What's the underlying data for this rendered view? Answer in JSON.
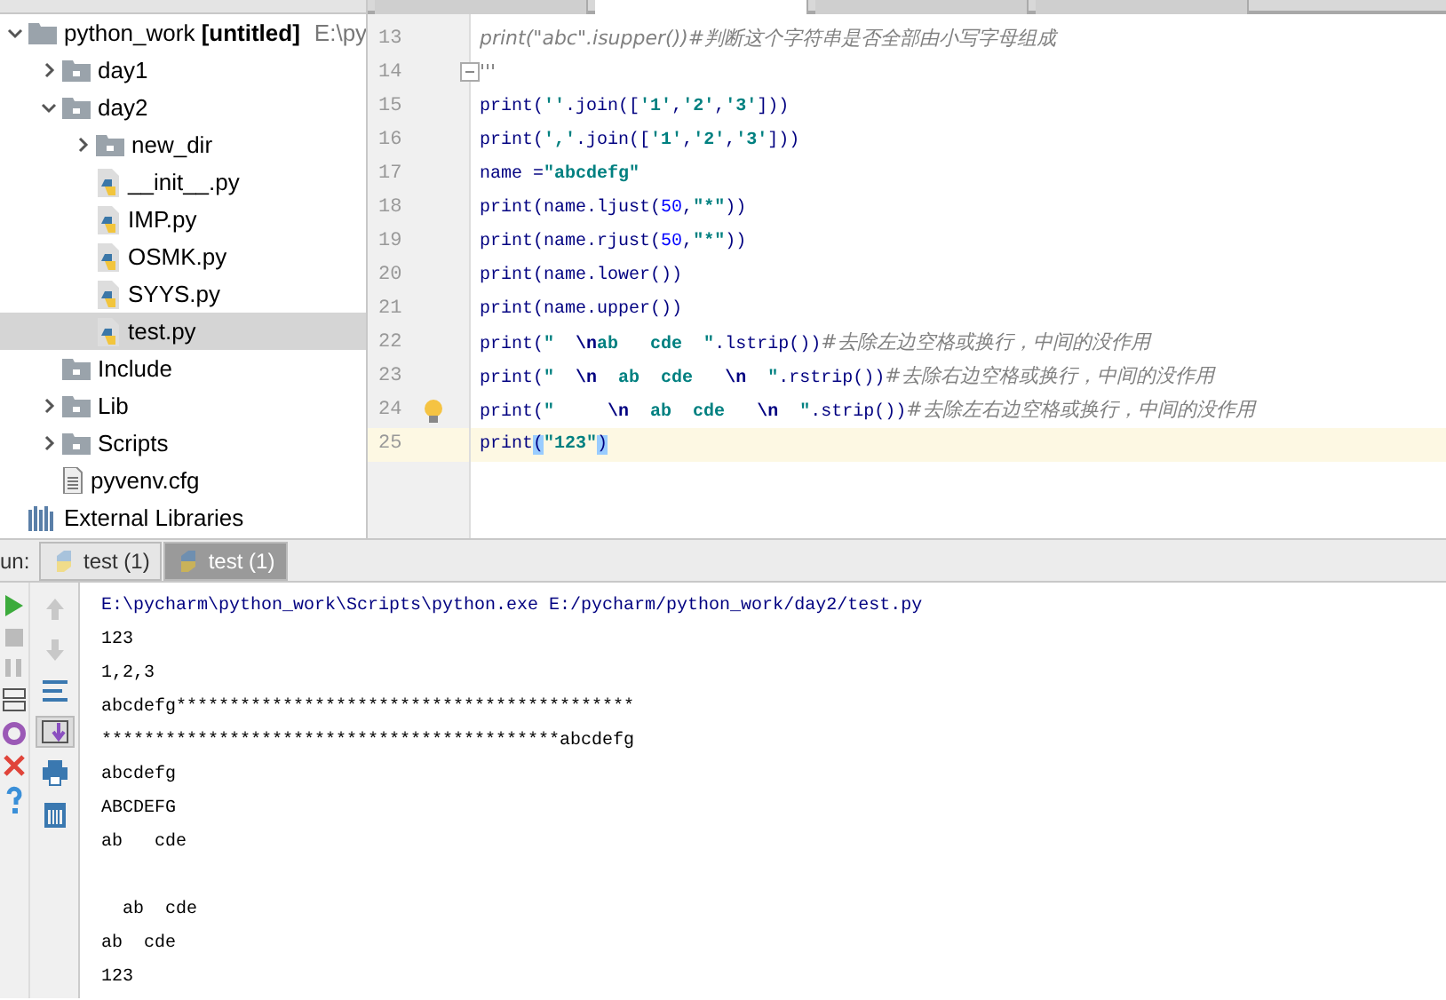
{
  "project_tree": [
    {
      "kind": "project",
      "label": "python_work **[untitled]**",
      "path": "E:\\py",
      "expanded": true,
      "selected": false,
      "children": [
        {
          "kind": "folder",
          "label": "day1",
          "expanded": false,
          "selected": false
        },
        {
          "kind": "folder",
          "label": "day2",
          "expanded": true,
          "selected": false,
          "children": [
            {
              "kind": "folder",
              "label": "new_dir",
              "expanded": false,
              "selected": false
            },
            {
              "kind": "pyfile",
              "label": "__init__.py",
              "selected": false
            },
            {
              "kind": "pyfile",
              "label": "IMP.py",
              "selected": false
            },
            {
              "kind": "pyfile",
              "label": "OSMK.py",
              "selected": false
            },
            {
              "kind": "pyfile",
              "label": "SYYS.py",
              "selected": false
            },
            {
              "kind": "pyfile",
              "label": "test.py",
              "selected": true
            }
          ]
        },
        {
          "kind": "folder",
          "label": "Include",
          "selected": false
        },
        {
          "kind": "folder",
          "label": "Lib",
          "expanded": false,
          "selected": false
        },
        {
          "kind": "folder",
          "label": "Scripts",
          "expanded": false,
          "selected": false
        },
        {
          "kind": "cfgfile",
          "label": "pyvenv.cfg",
          "selected": false
        }
      ]
    },
    {
      "kind": "libs",
      "label": "External Libraries",
      "selected": false
    }
  ],
  "editor_tabs": [
    {
      "selected": false
    },
    {
      "selected": true
    },
    {
      "selected": false
    },
    {
      "selected": false
    }
  ],
  "code_lines": [
    {
      "number": "13",
      "current": false,
      "fold": false,
      "bulb": false,
      "segments": [
        {
          "kind": "comment",
          "t": "print(\"abc\".isupper())#判断这个字符串是否全部由小写字母组成"
        }
      ]
    },
    {
      "number": "14",
      "current": false,
      "fold": true,
      "bulb": false,
      "segments": [
        {
          "kind": "comment",
          "t": "'''"
        }
      ]
    },
    {
      "number": "15",
      "current": false,
      "fold": false,
      "bulb": false,
      "segments": [
        {
          "kind": "code",
          "t": "print("
        },
        {
          "kind": "str",
          "t": "''"
        },
        {
          "kind": "code",
          "t": ".join(["
        },
        {
          "kind": "str",
          "t": "'1'"
        },
        {
          "kind": "code",
          "t": ","
        },
        {
          "kind": "str",
          "t": "'2'"
        },
        {
          "kind": "code",
          "t": ","
        },
        {
          "kind": "str",
          "t": "'3'"
        },
        {
          "kind": "code",
          "t": "]))"
        }
      ]
    },
    {
      "number": "16",
      "current": false,
      "fold": false,
      "bulb": false,
      "segments": [
        {
          "kind": "code",
          "t": "print("
        },
        {
          "kind": "str",
          "t": "','"
        },
        {
          "kind": "code",
          "t": ".join(["
        },
        {
          "kind": "str",
          "t": "'1'"
        },
        {
          "kind": "code",
          "t": ","
        },
        {
          "kind": "str",
          "t": "'2'"
        },
        {
          "kind": "code",
          "t": ","
        },
        {
          "kind": "str",
          "t": "'3'"
        },
        {
          "kind": "code",
          "t": "]))"
        }
      ]
    },
    {
      "number": "17",
      "current": false,
      "fold": false,
      "bulb": false,
      "segments": [
        {
          "kind": "code",
          "t": "name ="
        },
        {
          "kind": "str",
          "t": "\"abcdefg\""
        }
      ]
    },
    {
      "number": "18",
      "current": false,
      "fold": false,
      "bulb": false,
      "segments": [
        {
          "kind": "code",
          "t": "print(name.ljust("
        },
        {
          "kind": "num",
          "t": "50"
        },
        {
          "kind": "code",
          "t": ","
        },
        {
          "kind": "str",
          "t": "\"*\""
        },
        {
          "kind": "code",
          "t": "))"
        }
      ]
    },
    {
      "number": "19",
      "current": false,
      "fold": false,
      "bulb": false,
      "segments": [
        {
          "kind": "code",
          "t": "print(name.rjust("
        },
        {
          "kind": "num",
          "t": "50"
        },
        {
          "kind": "code",
          "t": ","
        },
        {
          "kind": "str",
          "t": "\"*\""
        },
        {
          "kind": "code",
          "t": "))"
        }
      ]
    },
    {
      "number": "20",
      "current": false,
      "fold": false,
      "bulb": false,
      "segments": [
        {
          "kind": "code",
          "t": "print(name.lower())"
        }
      ]
    },
    {
      "number": "21",
      "current": false,
      "fold": false,
      "bulb": false,
      "segments": [
        {
          "kind": "code",
          "t": "print(name.upper())"
        }
      ]
    },
    {
      "number": "22",
      "current": false,
      "fold": false,
      "bulb": false,
      "segments": [
        {
          "kind": "code",
          "t": "print("
        },
        {
          "kind": "str",
          "t": "\"  "
        },
        {
          "kind": "esc",
          "t": "\\n"
        },
        {
          "kind": "str",
          "t": "ab   cde  \""
        },
        {
          "kind": "code",
          "t": ".lstrip())"
        },
        {
          "kind": "comment",
          "t": "#去除左边空格或换行，中间的没作用"
        }
      ]
    },
    {
      "number": "23",
      "current": false,
      "fold": false,
      "bulb": false,
      "segments": [
        {
          "kind": "code",
          "t": "print("
        },
        {
          "kind": "str",
          "t": "\"  "
        },
        {
          "kind": "esc",
          "t": "\\n"
        },
        {
          "kind": "str",
          "t": "  ab  cde   "
        },
        {
          "kind": "esc",
          "t": "\\n"
        },
        {
          "kind": "str",
          "t": "  \""
        },
        {
          "kind": "code",
          "t": ".rstrip())"
        },
        {
          "kind": "comment",
          "t": "#去除右边空格或换行，中间的没作用"
        }
      ]
    },
    {
      "number": "24",
      "current": false,
      "fold": false,
      "bulb": true,
      "segments": [
        {
          "kind": "code",
          "t": "print("
        },
        {
          "kind": "str",
          "t": "\"     "
        },
        {
          "kind": "esc",
          "t": "\\n"
        },
        {
          "kind": "str",
          "t": "  ab  cde   "
        },
        {
          "kind": "esc",
          "t": "\\n"
        },
        {
          "kind": "str",
          "t": "  \""
        },
        {
          "kind": "code",
          "t": ".strip())"
        },
        {
          "kind": "comment",
          "t": "#去除左右边空格或换行，中间的没作用"
        }
      ]
    },
    {
      "number": "25",
      "current": true,
      "fold": false,
      "bulb": false,
      "segments": [
        {
          "kind": "code",
          "t": "print"
        },
        {
          "kind": "brace",
          "t": "("
        },
        {
          "kind": "str",
          "t": "\"123\""
        },
        {
          "kind": "brace",
          "t": ")"
        }
      ]
    }
  ],
  "run_panel": {
    "label": "un:",
    "tabs": [
      {
        "label": "test (1)",
        "selected": false
      },
      {
        "label": "test (1)",
        "selected": true
      }
    ]
  },
  "console_lines": [
    {
      "kind": "command",
      "text": "E:\\pycharm\\python_work\\Scripts\\python.exe E:/pycharm/python_work/day2/test.py",
      "blank_before": false
    },
    {
      "kind": "output",
      "text": "123",
      "blank_before": false
    },
    {
      "kind": "output",
      "text": "1,2,3",
      "blank_before": false
    },
    {
      "kind": "output",
      "text": "abcdefg*******************************************",
      "blank_before": false
    },
    {
      "kind": "output",
      "text": "*******************************************abcdefg",
      "blank_before": false
    },
    {
      "kind": "output",
      "text": "abcdefg",
      "blank_before": false
    },
    {
      "kind": "output",
      "text": "ABCDEFG",
      "blank_before": false
    },
    {
      "kind": "output",
      "text": "ab   cde",
      "blank_before": false
    },
    {
      "kind": "output",
      "text": "  ab  cde",
      "blank_before": true
    },
    {
      "kind": "output",
      "text": "ab  cde",
      "blank_before": false
    },
    {
      "kind": "output",
      "text": "123",
      "blank_before": false
    }
  ]
}
